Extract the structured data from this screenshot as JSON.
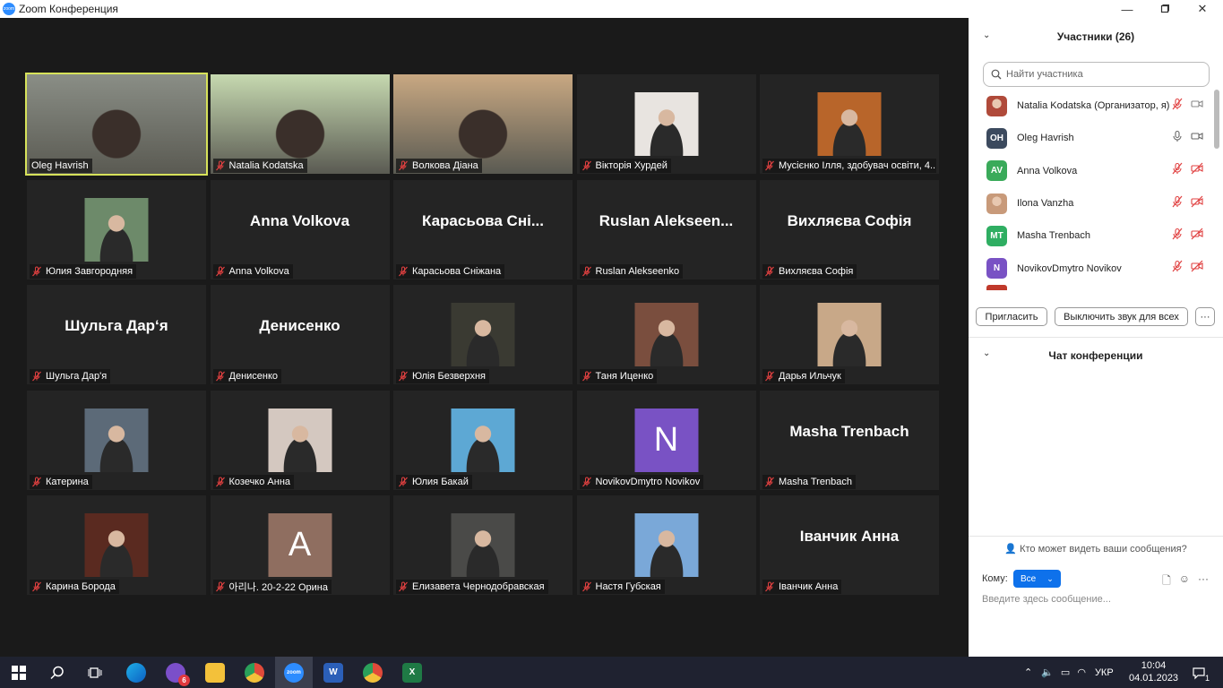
{
  "window": {
    "title": "Zoom Конференция",
    "logo_text": "zoom"
  },
  "tiles": [
    {
      "name": "Oleg Havrish",
      "type": "video",
      "bg": "#8a8e86",
      "active": true,
      "muted": false
    },
    {
      "name": "Natalia Kodatska",
      "type": "video",
      "bg": "#c6d9b0",
      "muted": true
    },
    {
      "name": "Волкова Діана",
      "type": "video",
      "bg": "#c9a882",
      "muted": true
    },
    {
      "name": "Вікторія Хурдей",
      "type": "photo",
      "bg": "#e8e4e0",
      "muted": true
    },
    {
      "name": "Мусієнко Ілля, здобувач освіти, 4...",
      "type": "photo",
      "bg": "#b8652a",
      "muted": true
    },
    {
      "name": "Юлия Завгородняя",
      "type": "photo",
      "bg": "#6d8a6a",
      "muted": true
    },
    {
      "name": "Anna Volkova",
      "type": "text",
      "big": "Anna Volkova",
      "muted": true
    },
    {
      "name": "Карасьова Сніжана",
      "type": "text",
      "big": "Карасьова  Сні...",
      "muted": true
    },
    {
      "name": "Ruslan Alekseenko",
      "type": "text",
      "big": "Ruslan  Alekseen...",
      "muted": true
    },
    {
      "name": "Вихляєва Софія",
      "type": "text",
      "big": "Вихляєва Софія",
      "muted": true
    },
    {
      "name": "Шульга Дар'я",
      "type": "text",
      "big": "Шульга Дар‘я",
      "muted": true
    },
    {
      "name": "Денисенко",
      "type": "text",
      "big": "Денисенко",
      "muted": true
    },
    {
      "name": "Юлія Безверхня",
      "type": "photo",
      "bg": "#3a3a32",
      "muted": true
    },
    {
      "name": "Таня Иценко",
      "type": "photo",
      "bg": "#7a4e3e",
      "muted": true
    },
    {
      "name": "Дарья Ильчук",
      "type": "photo",
      "bg": "#c8a888",
      "muted": true
    },
    {
      "name": "Катерина",
      "type": "photo",
      "bg": "#5c6a78",
      "muted": true
    },
    {
      "name": "Козечко Анна",
      "type": "photo",
      "bg": "#d4c8c0",
      "muted": true
    },
    {
      "name": "Юлия Бакай",
      "type": "photo",
      "bg": "#5da8d4",
      "muted": true
    },
    {
      "name": "NovikovDmytro Novikov",
      "type": "letter",
      "letter": "N",
      "bg": "#7952c4",
      "muted": true
    },
    {
      "name": "Masha Trenbach",
      "type": "text",
      "big": "Masha Trenbach",
      "muted": true
    },
    {
      "name": "Карина Борода",
      "type": "photo",
      "bg": "#5a2a20",
      "muted": true
    },
    {
      "name": "아리나. 20-2-22 Орина",
      "type": "letter",
      "letter": "A",
      "bg": "#8f6e60",
      "muted": true
    },
    {
      "name": "Елизавета Чернодобравская",
      "type": "photo",
      "bg": "#4a4a48",
      "muted": true
    },
    {
      "name": "Настя Губская",
      "type": "photo",
      "bg": "#7aa8d8",
      "muted": true
    },
    {
      "name": "Іванчик Анна",
      "type": "text",
      "big": "Іванчик Анна",
      "muted": true
    }
  ],
  "participants_panel": {
    "title": "Участники (26)",
    "search_placeholder": "Найти участника",
    "list": [
      {
        "name": "Natalia Kodatska (Организатор, я)",
        "initials": "",
        "color": "#b04a3a",
        "mic": "muted",
        "video": "off-gray"
      },
      {
        "name": "Oleg Havrish",
        "initials": "OH",
        "color": "#3c4a5e",
        "mic": "on",
        "video": "on"
      },
      {
        "name": "Anna Volkova",
        "initials": "AV",
        "color": "#3aaa5a",
        "mic": "muted",
        "video": "off"
      },
      {
        "name": "Ilona Vanzha",
        "initials": "",
        "color": "#c89a7a",
        "mic": "muted",
        "video": "off"
      },
      {
        "name": "Masha Trenbach",
        "initials": "MT",
        "color": "#2fae62",
        "mic": "muted",
        "video": "off"
      },
      {
        "name": "NovikovDmytro Novikov",
        "initials": "N",
        "color": "#7952c4",
        "mic": "muted",
        "video": "off"
      }
    ],
    "invite_label": "Пригласить",
    "mute_all_label": "Выключить звук для всех",
    "more_label": "···"
  },
  "chat_panel": {
    "title": "Чат конференции",
    "visibility_note": "Кто может видеть ваши сообщения?",
    "to_label": "Кому:",
    "to_value": "Все",
    "input_placeholder": "Введите здесь сообщение..."
  },
  "taskbar": {
    "badge_count": "6",
    "language": "УКР",
    "time": "10:04",
    "date": "04.01.2023",
    "notification_count": "1"
  }
}
